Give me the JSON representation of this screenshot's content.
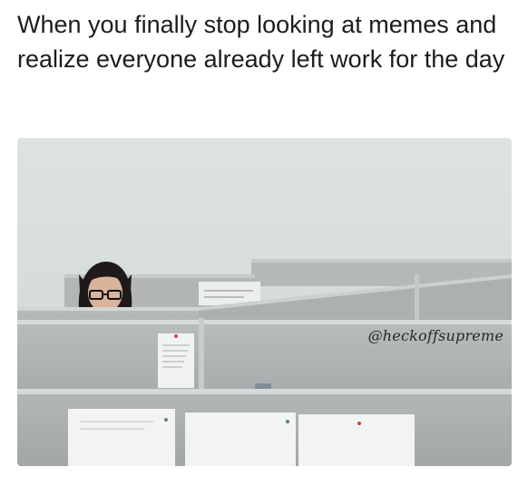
{
  "caption": {
    "text": "When you finally stop looking at memes and realize everyone already left work for the day"
  },
  "photo": {
    "watermark": "@heckoffsupreme"
  }
}
